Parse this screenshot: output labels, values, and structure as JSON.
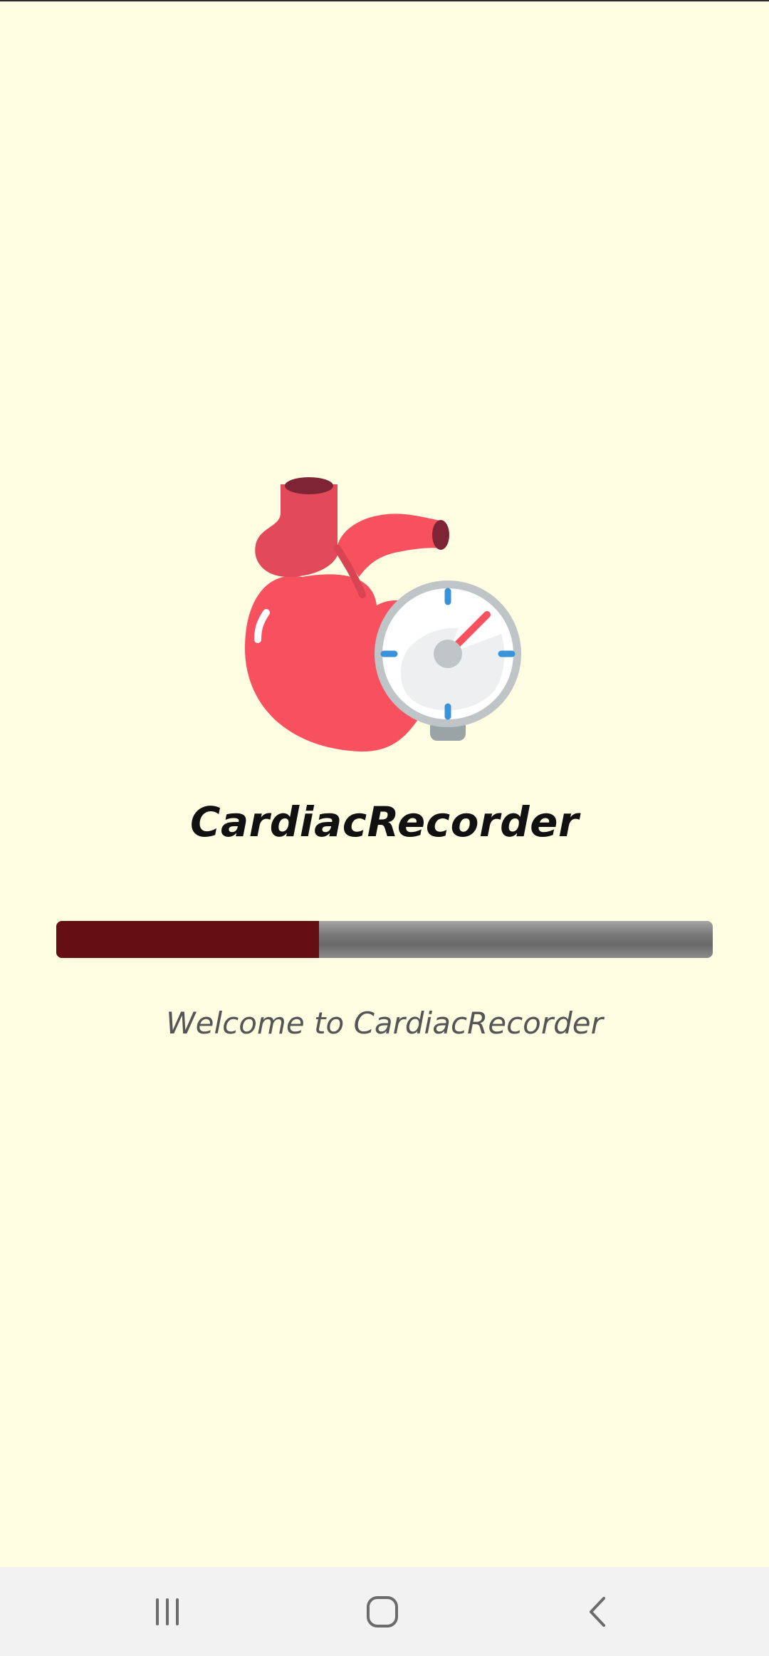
{
  "app": {
    "title": "CardiacRecorder",
    "welcome": "Welcome to CardiacRecorder",
    "logo_icon": "heart-pressure-gauge-icon"
  },
  "loading": {
    "progress": 0.4
  },
  "colors": {
    "background": "#FFFEE3",
    "progress_fill": "#650F12",
    "progress_track": "#7a7a7a",
    "heart": "#F7505E",
    "nav_bar": "#F2F2F2"
  },
  "nav": {
    "recents_icon": "recents-icon",
    "home_icon": "home-icon",
    "back_icon": "back-icon"
  }
}
